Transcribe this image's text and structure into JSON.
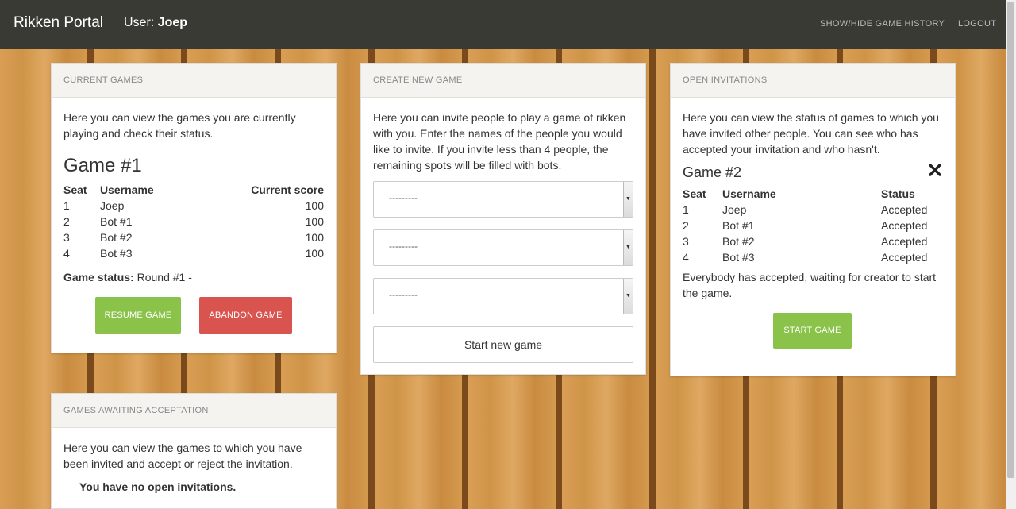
{
  "nav": {
    "brand": "Rikken Portal",
    "user_label": "User:",
    "user_name": "Joep",
    "links": [
      "SHOW/HIDE GAME HISTORY",
      "LOGOUT"
    ]
  },
  "current_games": {
    "heading": "CURRENT GAMES",
    "intro": "Here you can view the games you are currently playing and check their status.",
    "game_title": "Game #1",
    "columns": [
      "Seat",
      "Username",
      "Current score"
    ],
    "rows": [
      {
        "seat": "1",
        "username": "Joep",
        "score": "100"
      },
      {
        "seat": "2",
        "username": "Bot #1",
        "score": "100"
      },
      {
        "seat": "3",
        "username": "Bot #2",
        "score": "100"
      },
      {
        "seat": "4",
        "username": "Bot #3",
        "score": "100"
      }
    ],
    "status_label": "Game status:",
    "status_value": "Round #1 -",
    "resume_label": "RESUME GAME",
    "abandon_label": "ABANDON GAME"
  },
  "create_game": {
    "heading": "CREATE NEW GAME",
    "intro": "Here you can invite people to play a game of rikken with you. Enter the names of the people you would like to invite. If you invite less than 4 people, the remaining spots will be filled with bots.",
    "selects": [
      "---------",
      "---------",
      "---------"
    ],
    "start_label": "Start new game"
  },
  "open_invitations": {
    "heading": "OPEN INVITATIONS",
    "intro": "Here you can view the status of games to which you have invited other people. You can see who has accepted your invitation and who hasn't.",
    "game_title": "Game #2",
    "columns": [
      "Seat",
      "Username",
      "Status"
    ],
    "rows": [
      {
        "seat": "1",
        "username": "Joep",
        "status": "Accepted"
      },
      {
        "seat": "2",
        "username": "Bot #1",
        "status": "Accepted"
      },
      {
        "seat": "3",
        "username": "Bot #2",
        "status": "Accepted"
      },
      {
        "seat": "4",
        "username": "Bot #3",
        "status": "Accepted"
      }
    ],
    "message": "Everybody has accepted, waiting for creator to start the game.",
    "start_label": "START GAME",
    "close_icon": "close-icon"
  },
  "awaiting": {
    "heading": "GAMES AWAITING ACCEPTATION",
    "intro": "Here you can view the games to which you have been invited and accept or reject the invitation.",
    "empty": "You have no open invitations."
  },
  "colors": {
    "navbar": "#3a3a35",
    "green": "#8bc34a",
    "red": "#d9534f",
    "panel_head": "#f5f3ef"
  }
}
